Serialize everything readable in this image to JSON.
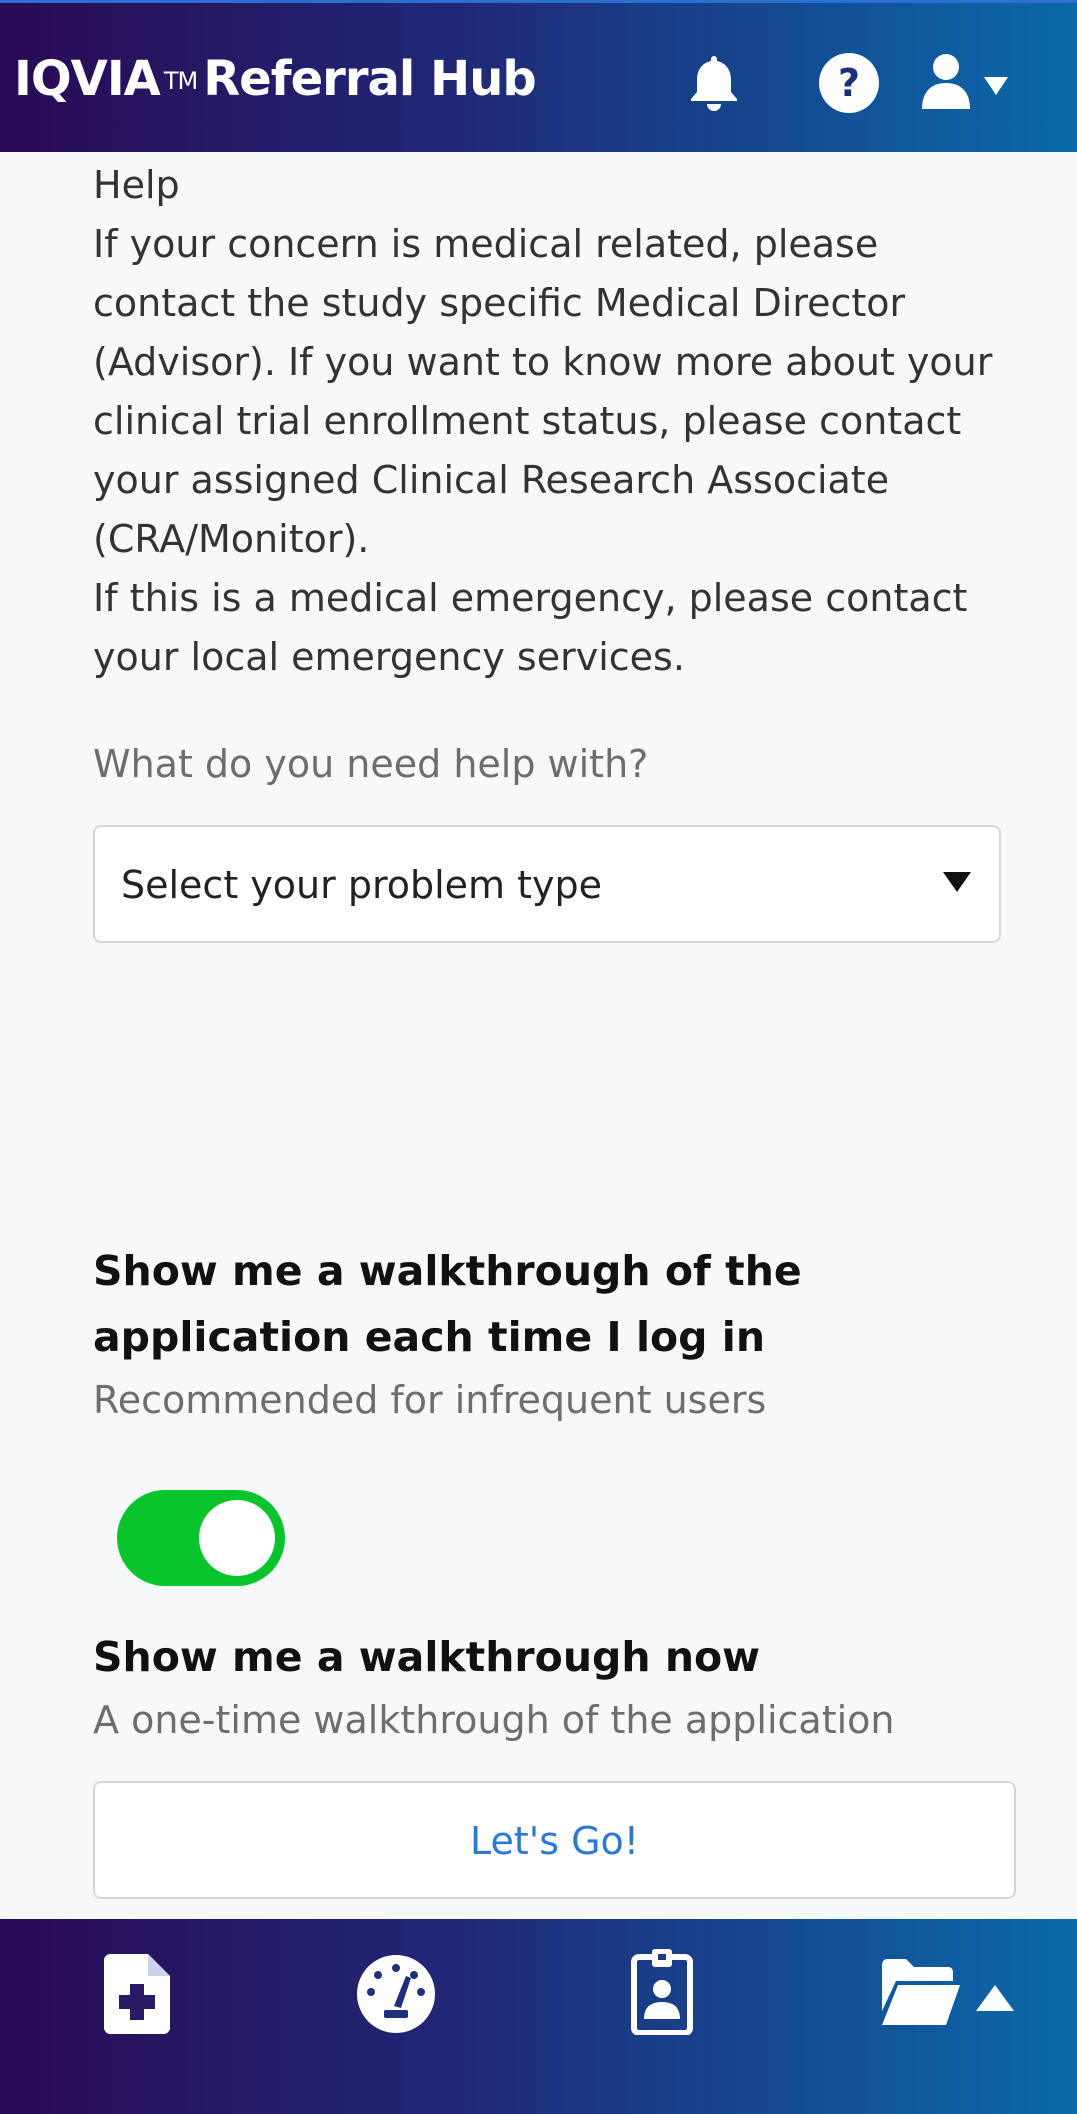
{
  "header": {
    "brand": "IQVIA",
    "trademark": "TM",
    "product": "Referral Hub",
    "icons": [
      "bell-icon",
      "help-icon",
      "user-icon",
      "caret-down-icon"
    ]
  },
  "help": {
    "title": "Help",
    "paragraph1": "If your concern is medical related, please contact the study specific Medical Director (Advisor). If you want to know more about your clinical trial enrollment status, please contact your assigned Clinical Research Associate (CRA/Monitor).",
    "paragraph2": "If this is a medical emergency, please contact your local emergency services."
  },
  "problem": {
    "question": "What do you need help with?",
    "selected": "Select your problem type"
  },
  "walkthrough": {
    "title": "Show me a walkthrough of the application each time I log in",
    "subtitle": "Recommended for infrequent users",
    "enabled": true,
    "toggle_color": "#07c42c"
  },
  "walkthrough_now": {
    "title": "Show me a walkthrough now",
    "subtitle": "A one-time walkthrough of the application",
    "button_label": "Let's Go!"
  },
  "footer": {
    "icons": [
      "new-referral-icon",
      "dashboard-icon",
      "badge-icon",
      "folder-icon",
      "caret-up-icon"
    ]
  },
  "colors": {
    "header_start": "#2a0a55",
    "header_end": "#0a6aaa",
    "link": "#2b79d6"
  }
}
